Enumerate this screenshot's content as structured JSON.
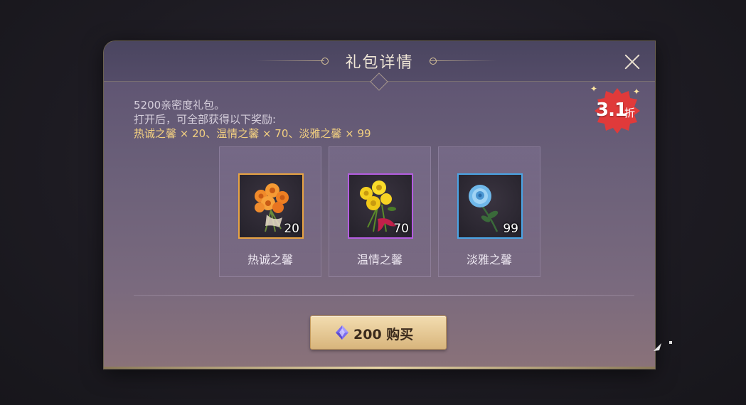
{
  "dialog": {
    "title": "礼包详情",
    "description_line1": "5200亲密度礼包。",
    "description_line2": "打开后，可全部获得以下奖励:",
    "description_line3": "热诚之馨 × 20、温情之馨 × 70、淡雅之馨 × 99",
    "close_icon": "close-icon"
  },
  "discount_badge": {
    "value": "3.1",
    "unit": "折",
    "color": "#e03a3a"
  },
  "items": [
    {
      "name": "热诚之馨",
      "count": "20",
      "icon": "orange-rose-bouquet-icon",
      "rarity_color": "#e9a443"
    },
    {
      "name": "温情之馨",
      "count": "70",
      "icon": "yellow-rose-bouquet-icon",
      "rarity_color": "#b45de0"
    },
    {
      "name": "淡雅之馨",
      "count": "99",
      "icon": "blue-rose-icon",
      "rarity_color": "#4aa5e6"
    }
  ],
  "buy_button": {
    "price": "200",
    "label": "购买",
    "currency_icon": "diamond-gem-icon"
  }
}
